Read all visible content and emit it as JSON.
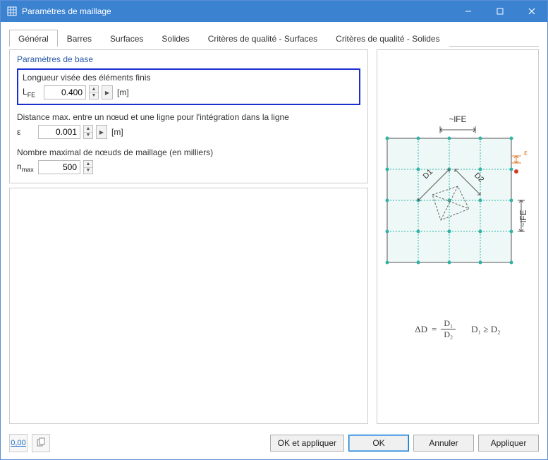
{
  "window": {
    "title": "Paramètres de maillage"
  },
  "tabs": [
    {
      "label": "Général",
      "active": true
    },
    {
      "label": "Barres",
      "active": false
    },
    {
      "label": "Surfaces",
      "active": false
    },
    {
      "label": "Solides",
      "active": false
    },
    {
      "label": "Critères de qualité - Surfaces",
      "active": false
    },
    {
      "label": "Critères de qualité - Solides",
      "active": false
    }
  ],
  "group": {
    "title": "Paramètres de base",
    "fields": {
      "lfe": {
        "label": "Longueur visée des éléments finis",
        "symbol": "L",
        "subscript": "FE",
        "value": "0.400",
        "unit": "[m]"
      },
      "eps": {
        "label": "Distance max. entre un nœud et une ligne pour l'intégration dans la ligne",
        "symbol": "ε",
        "subscript": "",
        "value": "0.001",
        "unit": "[m]"
      },
      "nmax": {
        "label": "Nombre maximal de nœuds de maillage (en milliers)",
        "symbol": "n",
        "subscript": "max",
        "value": "500",
        "unit": ""
      }
    }
  },
  "diagram": {
    "label_lfe_top": "~lFE",
    "label_lfe_right": "~lFE",
    "label_eps": "ε",
    "label_d1": "D1",
    "label_d2": "D2",
    "eq_left": "ΔD",
    "eq_d1": "D₁",
    "eq_d2": "D₂",
    "eq_cond": "D₁ ≥ D₂"
  },
  "footer": {
    "icon1": "0,00",
    "ok_apply": "OK et appliquer",
    "ok": "OK",
    "cancel": "Annuler",
    "apply": "Appliquer"
  }
}
